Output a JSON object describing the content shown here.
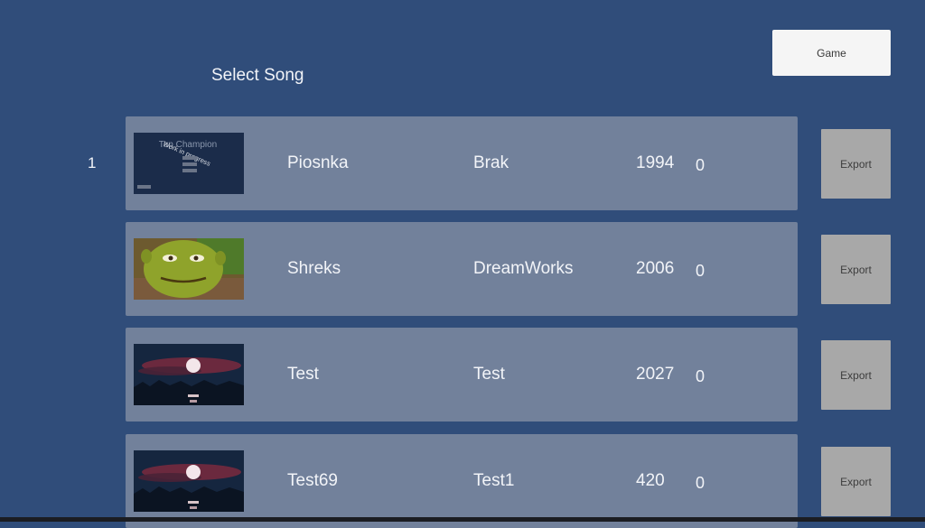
{
  "header": {
    "title": "Select Song",
    "game_button": "Game"
  },
  "songs": [
    {
      "index": "1",
      "thumbnail": "work-in-progress-screen",
      "thumbnail_caption": "Tap Champion",
      "thumbnail_overlay": "Work in progress",
      "title": "Piosnka",
      "artist": "Brak",
      "year": "1994",
      "score": "0",
      "export_label": "Export"
    },
    {
      "thumbnail": "shrek-face-image",
      "title": "Shreks",
      "artist": "DreamWorks",
      "year": "2006",
      "score": "0",
      "export_label": "Export"
    },
    {
      "thumbnail": "red-sunset-night-image",
      "title": "Test",
      "artist": "Test",
      "year": "2027",
      "score": "0",
      "export_label": "Export"
    },
    {
      "thumbnail": "red-sunset-night-image",
      "title": "Test69",
      "artist": "Test1",
      "year": "420",
      "score": "0",
      "export_label": "Export"
    }
  ]
}
